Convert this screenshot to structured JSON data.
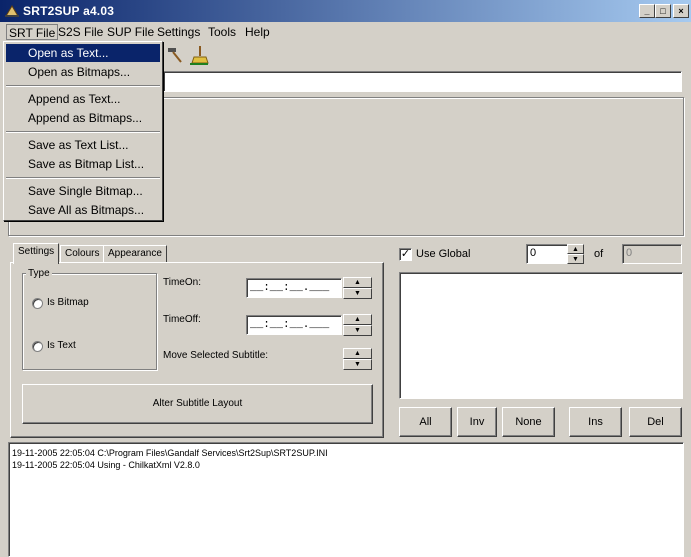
{
  "window": {
    "title": "SRT2SUP a4.03",
    "min": "_",
    "max": "□",
    "close": "×"
  },
  "menubar": [
    "SRT File",
    "S2S File",
    "SUP File",
    "Settings",
    "Tools",
    "Help"
  ],
  "srt_menu": {
    "items": [
      "Open as Text...",
      "Open as Bitmaps...",
      "Append as Text...",
      "Append as Bitmaps...",
      "Save as Text List...",
      "Save as Bitmap List...",
      "Save Single Bitmap...",
      "Save All as Bitmaps..."
    ],
    "highlighted": "Open as Text..."
  },
  "tabs": [
    "Settings",
    "Colours",
    "Appearance"
  ],
  "settings": {
    "type_group": "Type",
    "is_bitmap": "Is Bitmap",
    "is_text": "Is Text",
    "time_on_label": "TimeOn:",
    "time_on_value": "__:__:__.___",
    "time_off_label": "TimeOff:",
    "time_off_value": "__:__:__.___",
    "move_label": "Move Selected Subtitle:",
    "alter_button": "Alter Subtitle Layout"
  },
  "right": {
    "use_global": "Use Global",
    "use_global_checked": true,
    "counter_value": "0",
    "of_label": "of",
    "total_value": "0"
  },
  "buttons": {
    "all": "All",
    "inv": "Inv",
    "none": "None",
    "ins": "Ins",
    "del": "Del"
  },
  "log": [
    "19-11-2005 22:05:04 C:\\Program Files\\Gandalf Services\\Srt2Sup\\SRT2SUP.INI",
    "19-11-2005 22:05:04 Using - ChilkatXml V2.8.0"
  ]
}
